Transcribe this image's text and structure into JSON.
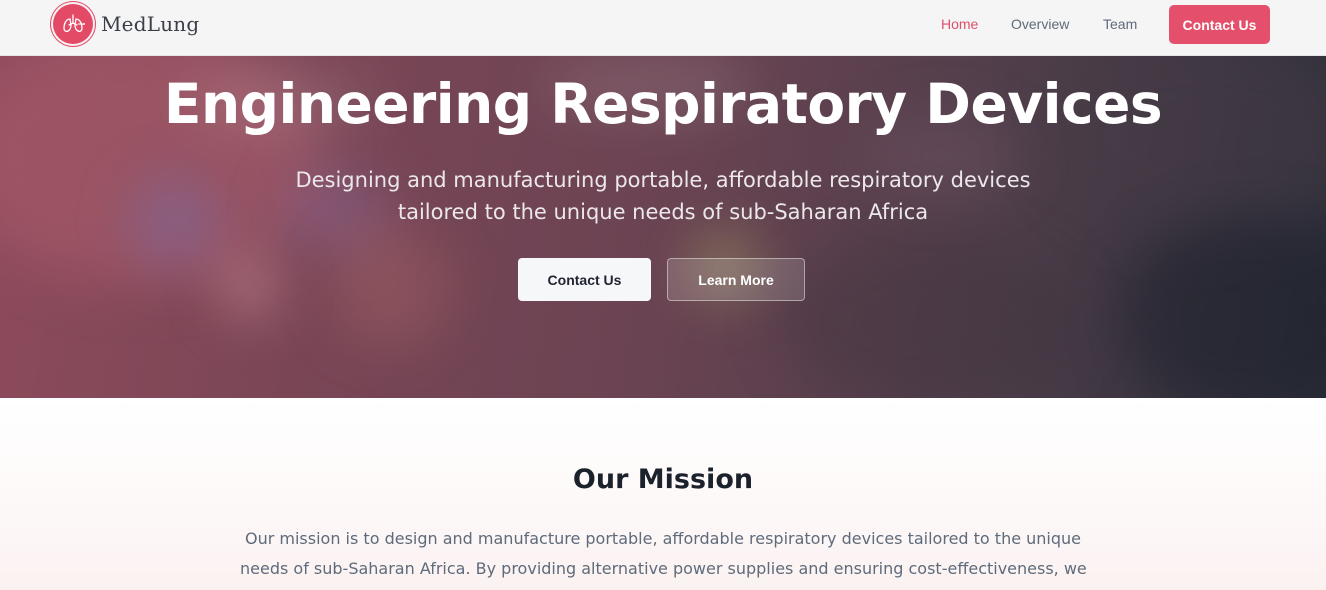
{
  "brand": {
    "name": "MedLung",
    "logo_icon": "lungs-icon",
    "accent_color": "#e4506b"
  },
  "nav": {
    "items": [
      {
        "label": "Home",
        "active": true
      },
      {
        "label": "Overview",
        "active": false
      },
      {
        "label": "Team",
        "active": false
      }
    ],
    "cta_label": "Contact Us"
  },
  "hero": {
    "title": "Engineering Respiratory Devices",
    "subtitle_lines": [
      "Designing and manufacturing portable, affordable respiratory devices",
      "tailored to the unique needs of sub-Saharan Africa"
    ],
    "primary_button": "Contact Us",
    "secondary_button": "Learn More"
  },
  "mission": {
    "title": "Our Mission",
    "text_lines": [
      "Our mission is to design and manufacture portable, affordable respiratory devices tailored to the unique",
      "needs of sub-Saharan Africa. By providing alternative power supplies and ensuring cost-effectiveness, we"
    ]
  }
}
